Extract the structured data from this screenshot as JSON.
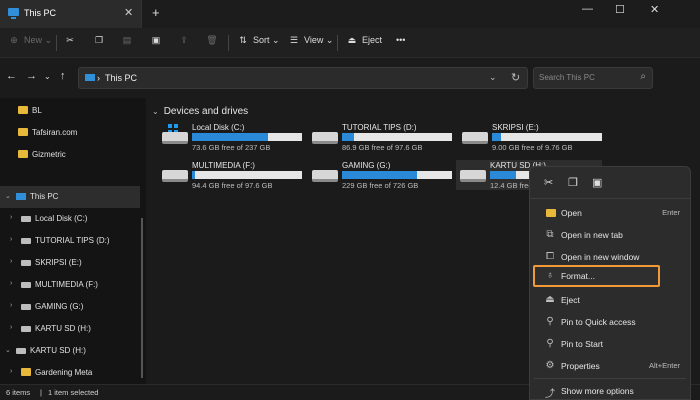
{
  "window": {
    "tab_title": "This PC",
    "tab_close": "✕",
    "new_tab": "+",
    "controls": [
      "—",
      "☐",
      "✕"
    ]
  },
  "toolbar": {
    "new_label": "New",
    "sort_label": "Sort",
    "view_label": "View",
    "eject_label": "Eject",
    "more_label": "•••"
  },
  "address": {
    "path": "This PC",
    "search_placeholder": "Search This PC"
  },
  "sidebar": {
    "items": [
      {
        "label": "BL"
      },
      {
        "label": "Tafsiran.com"
      },
      {
        "label": "Gizmetric"
      },
      {
        "label": "This PC"
      },
      {
        "label": "Local Disk (C:)"
      },
      {
        "label": "TUTORIAL TIPS (D:)"
      },
      {
        "label": "SKRIPSI (E:)"
      },
      {
        "label": "MULTIMEDIA (F:)"
      },
      {
        "label": "GAMING (G:)"
      },
      {
        "label": "KARTU SD (H:)"
      },
      {
        "label": "KARTU SD (H:)"
      },
      {
        "label": "Gardening Meta"
      }
    ]
  },
  "content": {
    "group_title": "Devices and drives",
    "drives": [
      {
        "name": "Local Disk (C:)",
        "free": "73.6 GB free of 237 GB",
        "used": 0.69
      },
      {
        "name": "TUTORIAL TIPS (D:)",
        "free": "86.9 GB free of 97.6 GB",
        "used": 0.11
      },
      {
        "name": "SKRIPSI (E:)",
        "free": "9.00 GB free of 9.76 GB",
        "used": 0.08
      },
      {
        "name": "MULTIMEDIA (F:)",
        "free": "94.4 GB free of 97.6 GB",
        "used": 0.03
      },
      {
        "name": "GAMING (G:)",
        "free": "229 GB free of 726 GB",
        "used": 0.68
      },
      {
        "name": "KARTU SD (H:)",
        "free": "12.4 GB free of 29.0 GB",
        "used": 0.57
      }
    ]
  },
  "status": {
    "count": "6 items",
    "selected": "1 item selected"
  },
  "context_menu": {
    "items": [
      {
        "label": "Open",
        "shortcut": "Enter"
      },
      {
        "label": "Open in new tab",
        "shortcut": ""
      },
      {
        "label": "Open in new window",
        "shortcut": ""
      },
      {
        "label": "Format...",
        "shortcut": ""
      },
      {
        "label": "Eject",
        "shortcut": ""
      },
      {
        "label": "Pin to Quick access",
        "shortcut": ""
      },
      {
        "label": "Pin to Start",
        "shortcut": ""
      },
      {
        "label": "Properties",
        "shortcut": "Alt+Enter"
      },
      {
        "label": "Show more options",
        "shortcut": ""
      }
    ]
  },
  "colors": {
    "accent": "#2a8ad8",
    "highlight_outline": "#f09a3a",
    "folder": "#e8b83a"
  }
}
